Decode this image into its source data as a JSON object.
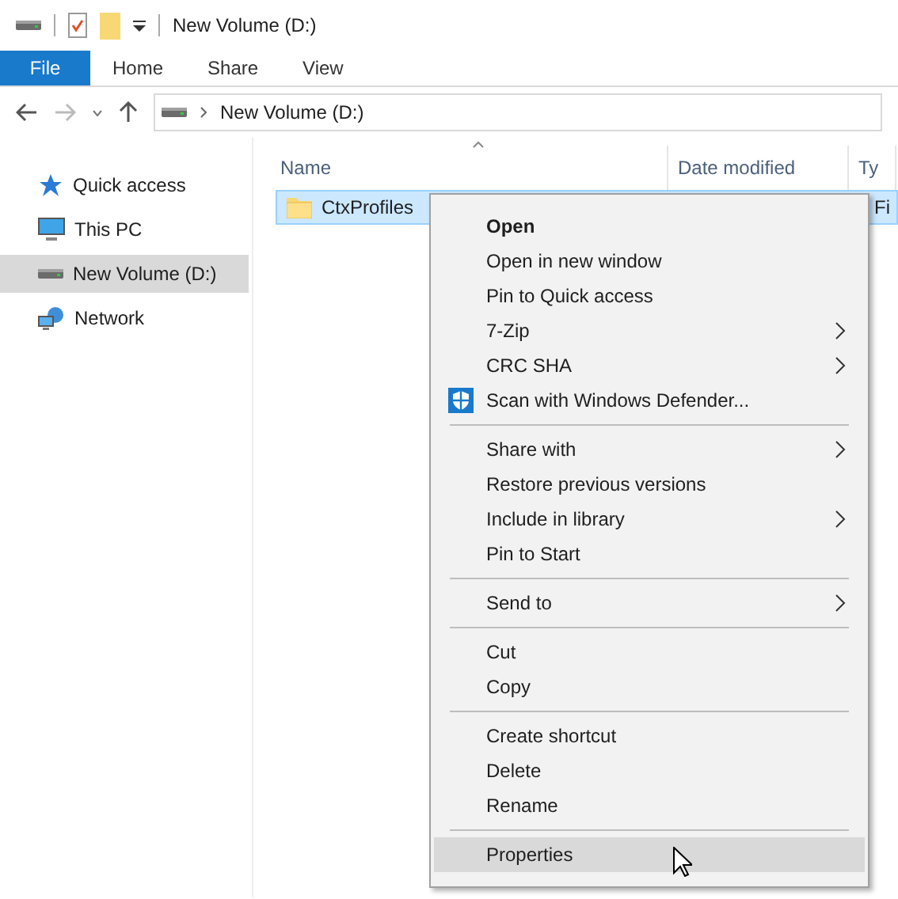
{
  "window": {
    "title": "New Volume (D:)"
  },
  "ribbon_tabs": [
    {
      "label": "File",
      "selected": true
    },
    {
      "label": "Home",
      "selected": false
    },
    {
      "label": "Share",
      "selected": false
    },
    {
      "label": "View",
      "selected": false
    }
  ],
  "address_bar": {
    "path": "New Volume (D:)"
  },
  "sidebar": {
    "items": [
      {
        "label": "Quick access",
        "kind": "star",
        "selected": false
      },
      {
        "label": "This PC",
        "kind": "pc",
        "selected": false
      },
      {
        "label": "New Volume (D:)",
        "kind": "drive",
        "selected": true
      },
      {
        "label": "Network",
        "kind": "network",
        "selected": false
      }
    ]
  },
  "table": {
    "columns": [
      "Name",
      "Date modified",
      "Ty"
    ],
    "rows": [
      {
        "name": "CtxProfiles",
        "type": "Fi",
        "selected": true
      }
    ]
  },
  "context_menu": {
    "items": [
      {
        "kind": "item",
        "label": "Open",
        "bold": true,
        "submenu": false,
        "selected": false
      },
      {
        "kind": "item",
        "label": "Open in new window",
        "bold": false,
        "submenu": false,
        "selected": false
      },
      {
        "kind": "item",
        "label": "Pin to Quick access",
        "bold": false,
        "submenu": false,
        "selected": false
      },
      {
        "kind": "item",
        "label": "7-Zip",
        "bold": false,
        "submenu": true,
        "selected": false
      },
      {
        "kind": "item",
        "label": "CRC SHA",
        "bold": false,
        "submenu": true,
        "selected": false
      },
      {
        "kind": "icon_item",
        "label": "Scan with Windows Defender...",
        "bold": false,
        "submenu": false,
        "selected": false
      },
      {
        "kind": "separator"
      },
      {
        "kind": "item",
        "label": "Share with",
        "bold": false,
        "submenu": true,
        "selected": false
      },
      {
        "kind": "item",
        "label": "Restore previous versions",
        "bold": false,
        "submenu": false,
        "selected": false
      },
      {
        "kind": "item",
        "label": "Include in library",
        "bold": false,
        "submenu": true,
        "selected": false
      },
      {
        "kind": "item",
        "label": "Pin to Start",
        "bold": false,
        "submenu": false,
        "selected": false
      },
      {
        "kind": "separator"
      },
      {
        "kind": "item",
        "label": "Send to",
        "bold": false,
        "submenu": true,
        "selected": false
      },
      {
        "kind": "separator"
      },
      {
        "kind": "item",
        "label": "Cut",
        "bold": false,
        "submenu": false,
        "selected": false
      },
      {
        "kind": "item",
        "label": "Copy",
        "bold": false,
        "submenu": false,
        "selected": false
      },
      {
        "kind": "separator"
      },
      {
        "kind": "item",
        "label": "Create shortcut",
        "bold": false,
        "submenu": false,
        "selected": false
      },
      {
        "kind": "item",
        "label": "Delete",
        "bold": false,
        "submenu": false,
        "selected": false
      },
      {
        "kind": "item",
        "label": "Rename",
        "bold": false,
        "submenu": false,
        "selected": false
      },
      {
        "kind": "separator"
      },
      {
        "kind": "item",
        "label": "Properties",
        "bold": false,
        "submenu": false,
        "selected": true
      }
    ]
  }
}
